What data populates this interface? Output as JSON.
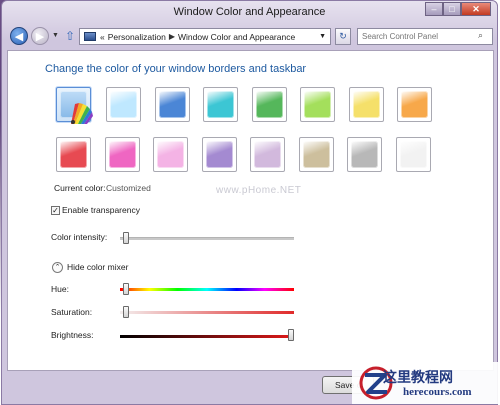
{
  "window": {
    "title": "Window Color and Appearance",
    "buttons": {
      "minimize": "–",
      "maximize": "□",
      "close": "✕"
    }
  },
  "nav": {
    "back_icon": "◀",
    "forward_icon": "▶",
    "up_icon": "⇧",
    "address": {
      "prefix": "«",
      "crumbs": [
        "Personalization",
        "Window Color and Appearance"
      ]
    },
    "refresh_icon": "↻",
    "search_placeholder": "Search Control Panel",
    "search_icon": "⌕"
  },
  "content": {
    "heading": "Change the color of your window borders and taskbar",
    "swatches": [
      "#bfe8ff",
      "#4b86d6",
      "#3cc6d4",
      "#55b75b",
      "#a4df5c",
      "#f5e06a",
      "#f7a84a",
      "#e74a52",
      "#ef66c2",
      "#f4b3e5",
      "#a48ad1",
      "#d2b9dd",
      "#cdbf9d",
      "#b8b8b8",
      "#f2f2f2"
    ],
    "current_color_label": "Current color:",
    "current_color_value": "Customized",
    "transparency_label": "Enable transparency",
    "transparency_checked": true,
    "intensity_label": "Color intensity:",
    "intensity_value": 0.02,
    "mixer_toggle_label": "Hide color mixer",
    "hue_label": "Hue:",
    "hue_value": 0.02,
    "saturation_label": "Saturation:",
    "saturation_value": 0.02,
    "brightness_label": "Brightness:",
    "brightness_value": 1.0,
    "save_button": "Save c"
  },
  "watermarks": {
    "center": "www.pHome.NET",
    "brand": "这里教程网",
    "url": "herecours.com"
  }
}
